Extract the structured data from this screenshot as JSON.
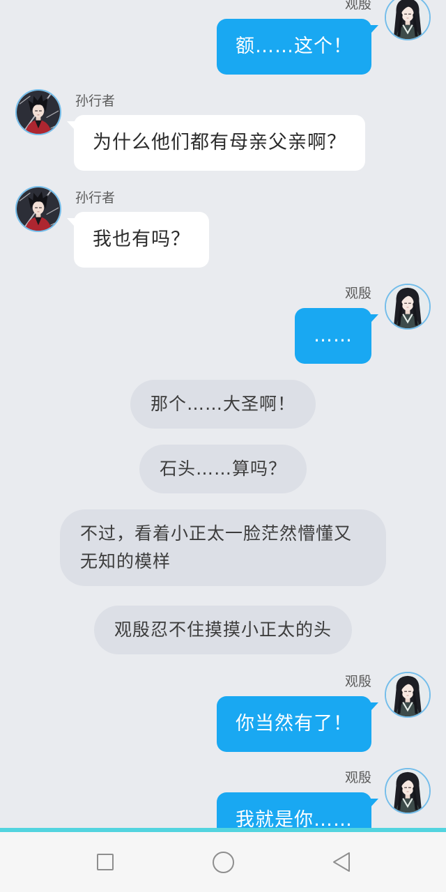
{
  "chat": {
    "messages": [
      {
        "name": "观殷",
        "text": "额……这个！"
      },
      {
        "name": "孙行者",
        "text": "为什么他们都有母亲父亲啊？"
      },
      {
        "name": "孙行者",
        "text": "我也有吗？"
      },
      {
        "name": "观殷",
        "text": "……"
      },
      {
        "text": "那个……大圣啊！"
      },
      {
        "text": "石头……算吗？"
      },
      {
        "text": "不过，看着小正太一脸茫然懵懂又无知的模样"
      },
      {
        "text": "观殷忍不住摸摸小正太的头"
      },
      {
        "name": "观殷",
        "text": "你当然有了！"
      },
      {
        "name": "观殷",
        "text": "我就是你……"
      }
    ]
  },
  "nav_bar": {
    "buttons": [
      {
        "icon": "recent-apps-icon"
      },
      {
        "icon": "home-icon"
      },
      {
        "icon": "back-icon"
      }
    ]
  },
  "colors": {
    "background": "#e9ebef",
    "outgoing_bubble": "#19a8f2",
    "incoming_bubble": "#ffffff",
    "narration_bubble": "#dcdfe6",
    "nav_accent_line": "#52d4df",
    "nav_bar": "#f6f6f6"
  }
}
